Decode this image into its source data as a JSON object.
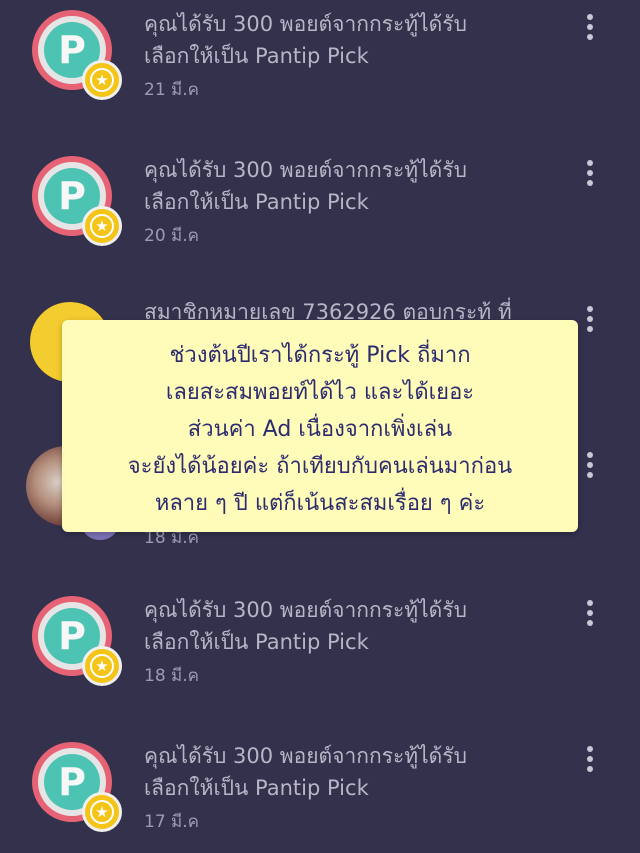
{
  "notifications": [
    {
      "line1": "คุณได้รับ 300 พอยต์จากกระทู้ได้รับ",
      "line2": "เลือกให้เป็น Pantip Pick",
      "date": "21 มี.ค",
      "avatar": "pantip-pick-badge"
    },
    {
      "line1": "คุณได้รับ 300 พอยต์จากกระทู้ได้รับ",
      "line2": "เลือกให้เป็น Pantip Pick",
      "date": "20 มี.ค",
      "avatar": "pantip-pick-badge"
    },
    {
      "line1": "สมาชิกหมายเลข 7362926 ตอบกระทู้ ที่",
      "avatar": "smiley-avatar"
    },
    {
      "date": "18 มี.ค",
      "avatar": "user-photo-avatar"
    },
    {
      "line1": "คุณได้รับ 300 พอยต์จากกระทู้ได้รับ",
      "line2": "เลือกให้เป็น Pantip Pick",
      "date": "18 มี.ค",
      "avatar": "pantip-pick-badge"
    },
    {
      "line1": "คุณได้รับ 300 พอยต์จากกระทู้ได้รับ",
      "line2": "เลือกให้เป็น Pantip Pick",
      "date": "17 มี.ค",
      "avatar": "pantip-pick-badge"
    }
  ],
  "badge_letter": "P",
  "caption": {
    "lines": [
      "ช่วงต้นปีเราได้กระทู้ Pick ถี่มาก",
      "เลยสะสมพอยท์ได้ไว และได้เยอะ",
      "ส่วนค่า Ad เนื่องจากเพิ่งเล่น",
      "จะยังได้น้อยค่ะ ถ้าเทียบกับคนเล่นมาก่อน",
      "หลาย ๆ ปี แต่ก็เน้นสะสมเรื่อย ๆ ค่ะ"
    ]
  },
  "colors": {
    "background": "#33314c",
    "caption_bg": "#fefcb8",
    "caption_text": "#2d2b70",
    "badge_red": "#e56374",
    "badge_teal": "#4cc3b3",
    "star_yellow": "#f4c417"
  }
}
